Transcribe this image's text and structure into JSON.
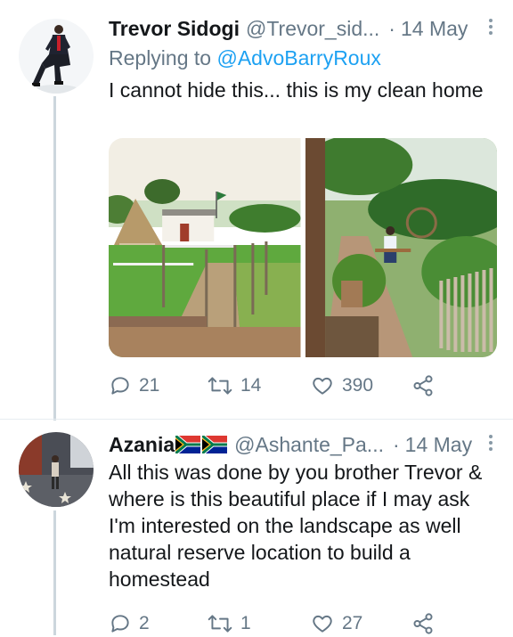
{
  "tweets": [
    {
      "name": "Trevor Sidogi",
      "handle": "@Trevor_sid...",
      "separator": "·",
      "date": "14 May",
      "replying_prefix": "Replying to",
      "replying_handle": "@AdvoBarryRoux",
      "text": "I cannot hide this... this is my clean home",
      "stats": {
        "replies": "21",
        "retweets": "14",
        "likes": "390"
      }
    },
    {
      "name": "Azania",
      "name_flags": [
        "south-africa-flag",
        "south-africa-flag"
      ],
      "handle": "@Ashante_Pa...",
      "separator": "·",
      "date": "14 May",
      "text": "All this was done by you brother Trevor & where is this beautiful place if I may ask I'm interested on the landscape as well natural reserve location to build a homestead",
      "stats": {
        "replies": "2",
        "retweets": "1",
        "likes": "27"
      }
    }
  ],
  "colors": {
    "secondary_text": "#657786",
    "link": "#1da1f2",
    "thread_line": "#ccd6dd",
    "primary_text": "#14171a"
  },
  "icons": [
    "reply-icon",
    "retweet-icon",
    "like-icon",
    "share-icon",
    "more-icon"
  ]
}
